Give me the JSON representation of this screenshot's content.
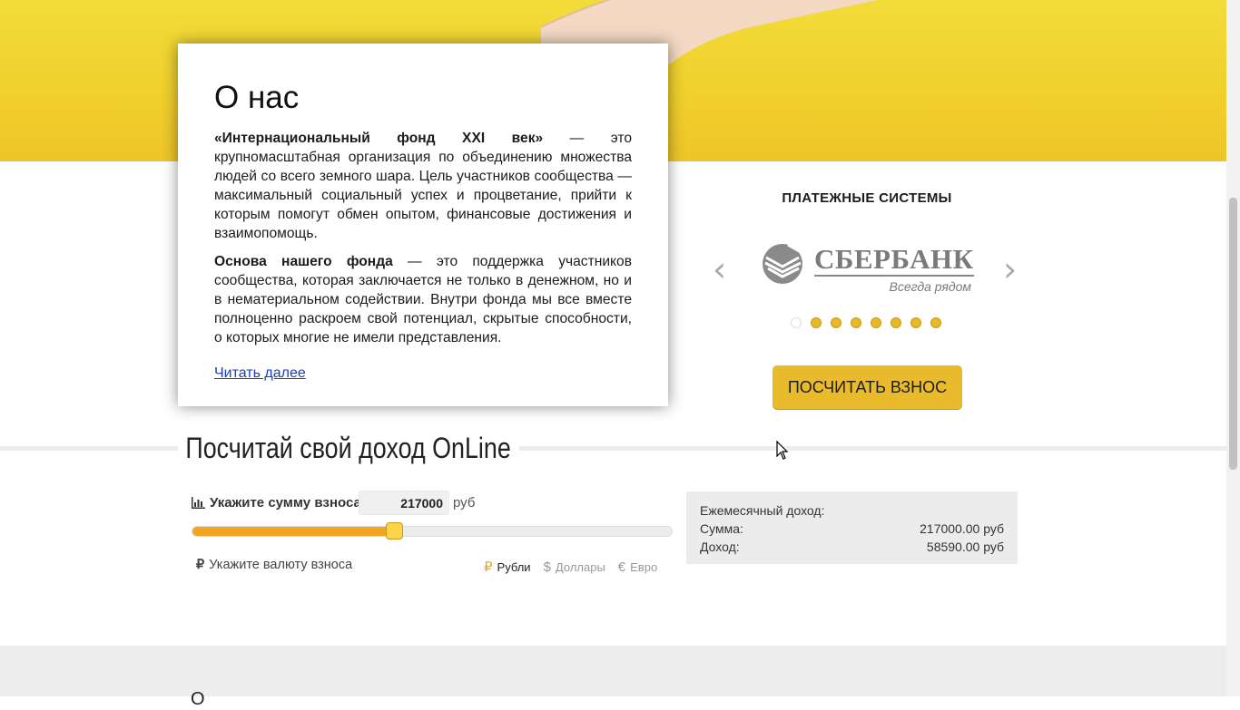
{
  "about": {
    "title": "О нас",
    "p1_bold": "«Интернациональный фонд XXI век»",
    "p1_rest": " — это крупномасштабная организация по объединению множества людей со всего земного шара. Цель участников сообщества — максимальный социальный успех и процветание, прийти к которым помогут обмен опытом, финансовые достижения и взаимопомощь.",
    "p2_bold": "Основа нашего фонда",
    "p2_rest": " — это поддержка участников сообщества, которая заключается не только в денежном, но и в нематериальном содействии. Внутри фонда мы все вместе полноценно раскроем свой потенциал, скрытые способности, о которых многие не имели представления.",
    "read_more": "Читать далее"
  },
  "payments": {
    "title": "ПЛАТЕЖНЫЕ СИСТЕМЫ",
    "prev_icon": "chevron-left-icon",
    "next_icon": "chevron-right-icon",
    "logo_name": "СБЕРБАНК",
    "logo_tagline": "Всегда рядом",
    "slide_count": 8,
    "active_slide": 1
  },
  "calc_button": "ПОСЧИТАТЬ ВЗНОС",
  "calculator": {
    "section_title": "Посчитай свой доход OnLine",
    "amount_label": "Укажите сумму взноса:",
    "amount_icon": "bar-chart-icon",
    "amount_value": "217000",
    "amount_unit": "руб",
    "slider_fraction": 0.42,
    "currency_label": "Укажите валюту взноса",
    "currency_icon": "ruble-icon",
    "currencies": [
      {
        "symbol": "₽",
        "label": "Рубли",
        "selected": true
      },
      {
        "symbol": "$",
        "label": "Доллары",
        "selected": false
      },
      {
        "symbol": "€",
        "label": "Евро",
        "selected": false
      }
    ]
  },
  "result": {
    "heading": "Ежемесячный доход:",
    "sum_label": "Сумма:",
    "sum_value": "217000.00 руб",
    "income_label": "Доход:",
    "income_value": "58590.00 руб"
  },
  "footer_partial": "О",
  "colors": {
    "hero_yellow": "#f0cf2c",
    "accent": "#e8ba2c",
    "slider_fill": "#f1a521"
  }
}
